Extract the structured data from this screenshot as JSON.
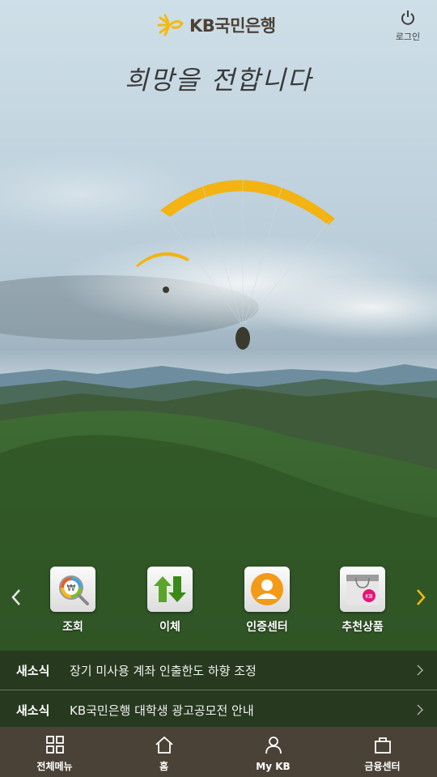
{
  "header": {
    "brand": "KB국민은행",
    "login_label": "로그인"
  },
  "hero": {
    "slogan": "희망을 전합니다"
  },
  "quick_menu": {
    "items": [
      {
        "label": "조회",
        "icon": "won-search-icon"
      },
      {
        "label": "이체",
        "icon": "transfer-arrows-icon"
      },
      {
        "label": "인증센터",
        "icon": "user-cert-icon"
      },
      {
        "label": "추천상품",
        "icon": "shopping-bag-icon"
      }
    ]
  },
  "news": [
    {
      "tag": "새소식",
      "text": "장기 미사용 계좌 인출한도 하향 조정"
    },
    {
      "tag": "새소식",
      "text": "KB국민은행 대학생 광고공모전 안내"
    }
  ],
  "tabbar": {
    "items": [
      {
        "label": "전체메뉴",
        "icon": "grid-menu-icon"
      },
      {
        "label": "홈",
        "icon": "home-icon"
      },
      {
        "label": "My KB",
        "icon": "person-icon"
      },
      {
        "label": "금융센터",
        "icon": "bag-icon"
      }
    ]
  },
  "colors": {
    "brand_yellow": "#f5b90f",
    "brand_brown": "#4a4237",
    "accent_arrow": "#f5b90f"
  }
}
